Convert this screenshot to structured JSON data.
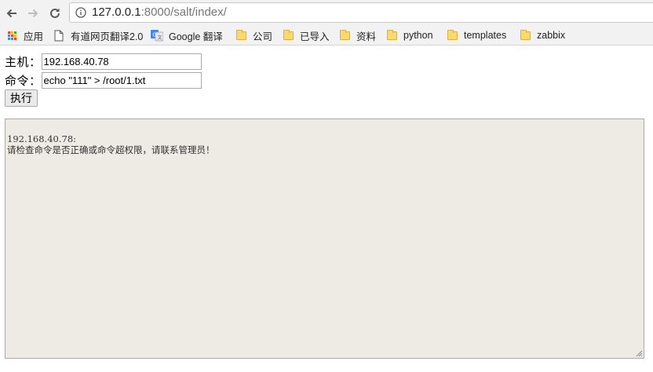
{
  "browser": {
    "url_host": "127.0.0.1",
    "url_path": ":8000/salt/index/",
    "bookmarks": [
      {
        "label": "应用",
        "icon": "apps-grid-icon"
      },
      {
        "label": "有道网页翻译2.0",
        "icon": "page-icon"
      },
      {
        "label": "Google 翻译",
        "icon": "google-translate-icon"
      },
      {
        "label": "公司",
        "icon": "folder-icon"
      },
      {
        "label": "已导入",
        "icon": "folder-icon"
      },
      {
        "label": "资料",
        "icon": "folder-icon"
      },
      {
        "label": "python",
        "icon": "folder-icon"
      },
      {
        "label": "templates",
        "icon": "folder-icon"
      },
      {
        "label": "zabbix",
        "icon": "folder-icon"
      }
    ]
  },
  "form": {
    "host_label": "主机：",
    "host_value": "192.168.40.78",
    "command_label": "命令：",
    "command_value": "echo \"111\" > /root/1.txt",
    "execute_label": "执行"
  },
  "output": {
    "line1": "192.168.40.78:",
    "line2": "请检查命令是否正确或命令超权限，请联系管理员！"
  },
  "colors": {
    "chrome_bg": "#f2f2f2",
    "output_bg": "#eeebe5",
    "folder": "#fbd96b"
  }
}
